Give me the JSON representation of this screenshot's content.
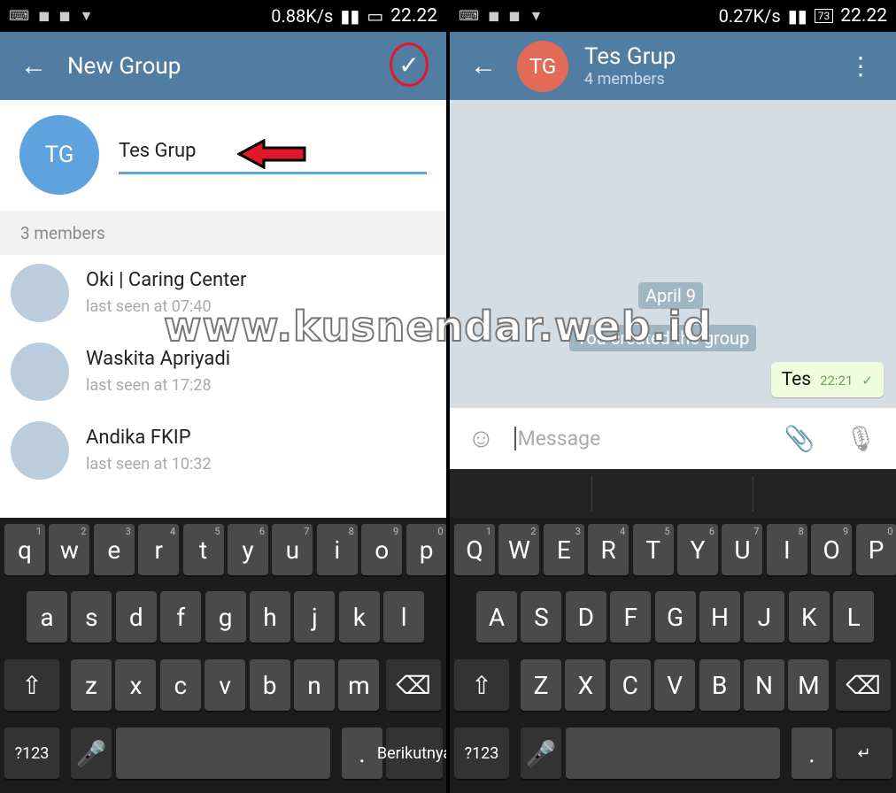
{
  "left": {
    "status": {
      "speed": "0.88K/s",
      "time": "22.22"
    },
    "appbar": {
      "title": "New Group",
      "back_icon": "arrow-left-icon",
      "confirm_icon": "check-icon"
    },
    "group": {
      "initials": "TG",
      "name": "Tes Grup"
    },
    "members_header": "3 members",
    "members": [
      {
        "name": "Oki | Caring Center",
        "seen": "last seen at 07:40"
      },
      {
        "name": "Waskita Apriyadi",
        "seen": "last seen at 17:28"
      },
      {
        "name": "Andika FKIP",
        "seen": "last seen at 10:32"
      }
    ],
    "keyboard": {
      "rows": [
        [
          "q",
          "w",
          "e",
          "r",
          "t",
          "y",
          "u",
          "i",
          "o",
          "p"
        ],
        [
          "a",
          "s",
          "d",
          "f",
          "g",
          "h",
          "j",
          "k",
          "l"
        ],
        [
          "z",
          "x",
          "c",
          "v",
          "b",
          "n",
          "m"
        ]
      ],
      "numbers": [
        "1",
        "2",
        "3",
        "4",
        "5",
        "6",
        "7",
        "8",
        "9",
        "0"
      ],
      "sym": "?123",
      "period": ".",
      "action": "Berikutnya"
    }
  },
  "right": {
    "status": {
      "speed": "0.27K/s",
      "time": "22.22",
      "battery": "73"
    },
    "appbar": {
      "initials": "TG",
      "title": "Tes Grup",
      "subtitle": "4 members"
    },
    "chat": {
      "date": "April 9",
      "service": "You created the group",
      "message": {
        "text": "Tes",
        "time": "22:21"
      }
    },
    "compose": {
      "placeholder": "Message"
    },
    "keyboard": {
      "rows": [
        [
          "Q",
          "W",
          "E",
          "R",
          "T",
          "Y",
          "U",
          "I",
          "O",
          "P"
        ],
        [
          "A",
          "S",
          "D",
          "F",
          "G",
          "H",
          "J",
          "K",
          "L"
        ],
        [
          "Z",
          "X",
          "C",
          "V",
          "B",
          "N",
          "M"
        ]
      ],
      "numbers": [
        "1",
        "2",
        "3",
        "4",
        "5",
        "6",
        "7",
        "8",
        "9",
        "0"
      ],
      "sym": "?123",
      "period": ".",
      "action": "↵"
    }
  },
  "watermark": "www.kusnendar.web.id",
  "colors": {
    "appbar": "#527da3",
    "accent": "#5fa3de",
    "highlight": "#e0192a",
    "group_avatar": "#e46a58"
  }
}
